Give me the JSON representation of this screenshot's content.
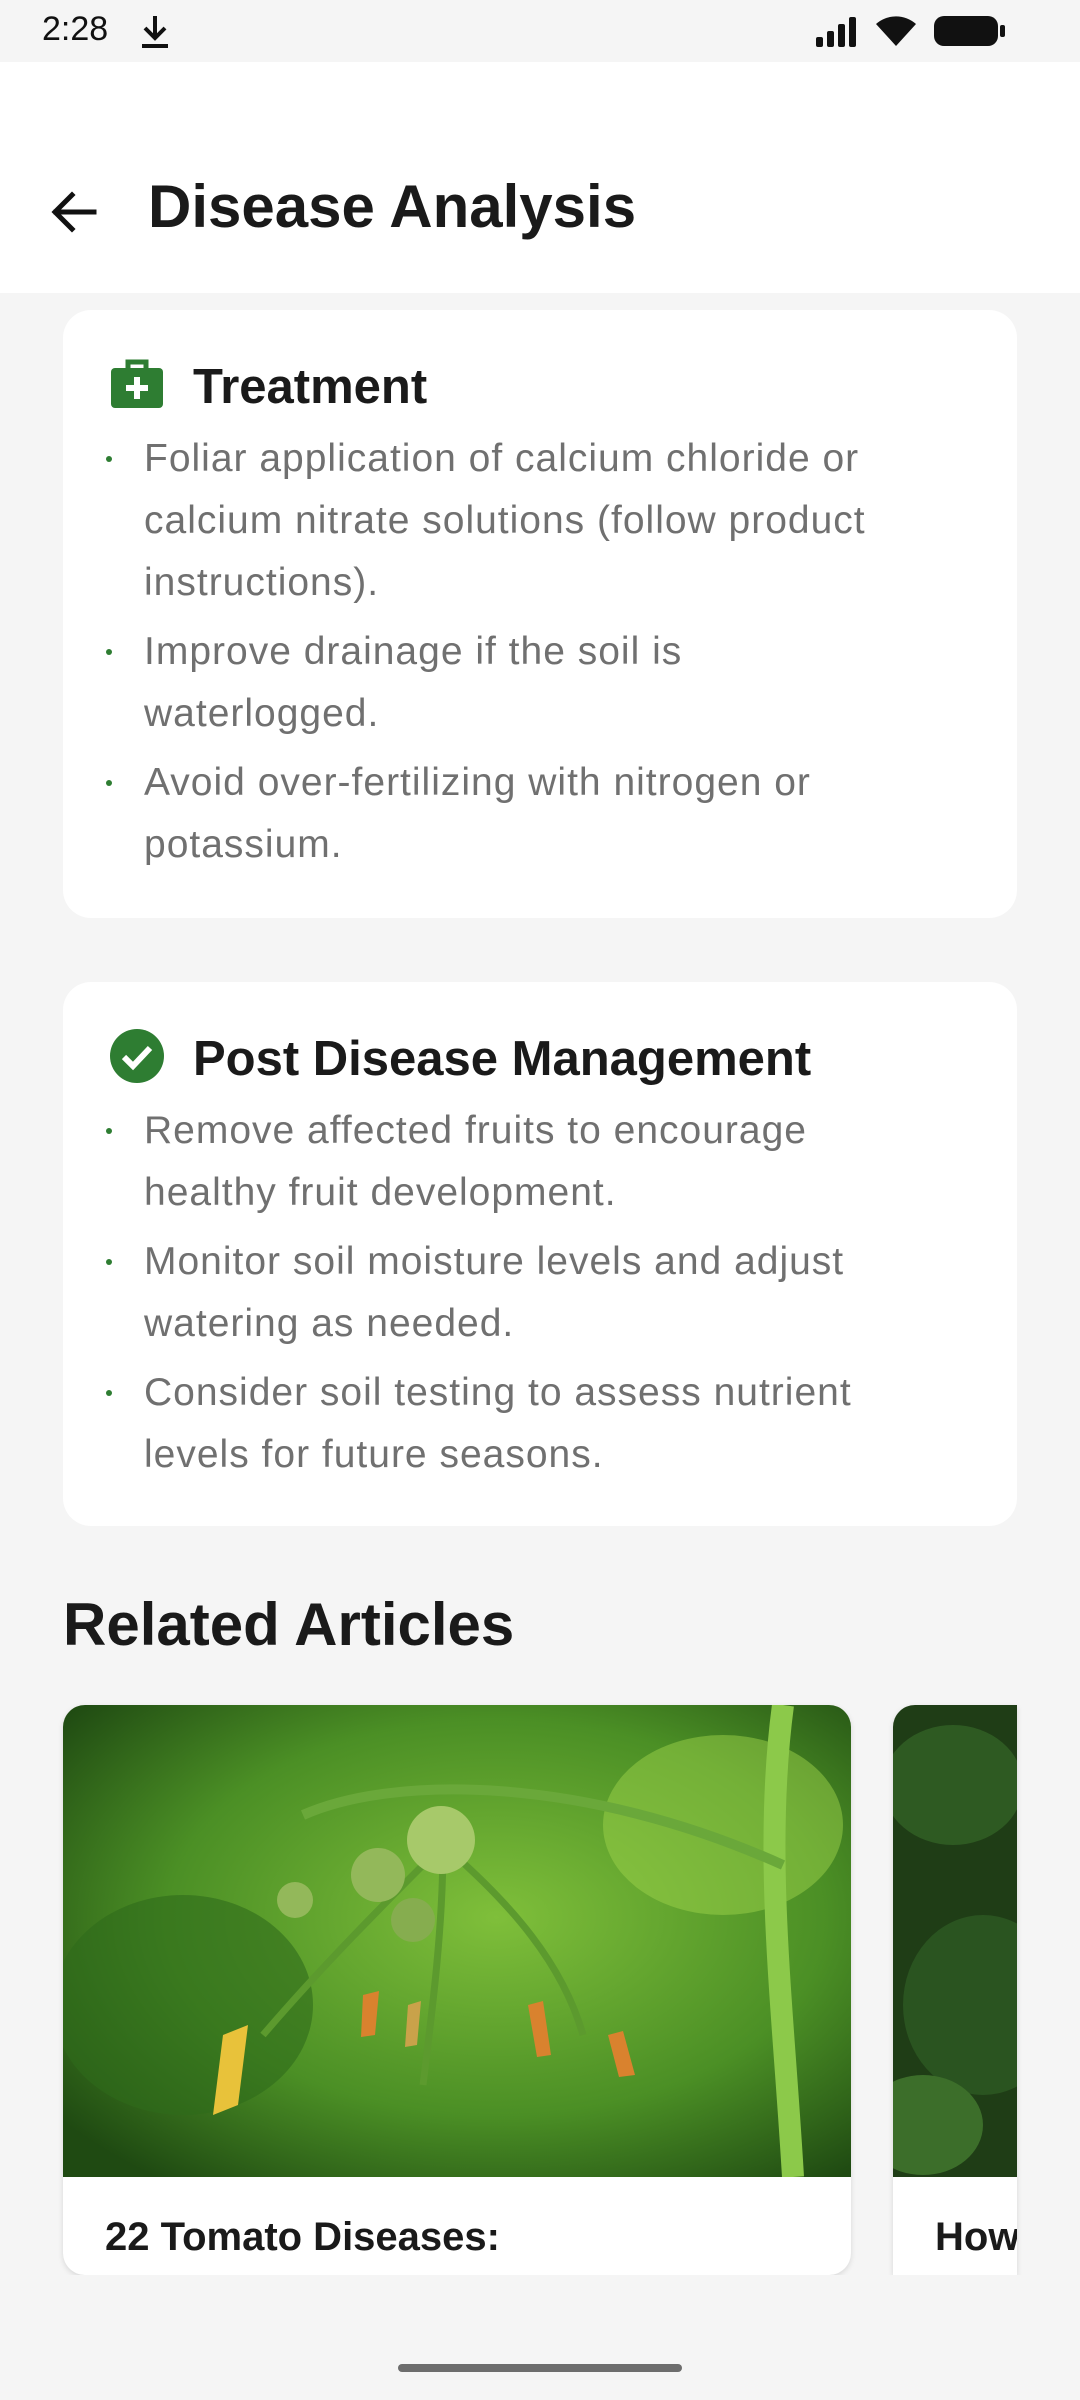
{
  "status_bar": {
    "time": "2:28",
    "icons": [
      "download-icon",
      "signal-icon",
      "wifi-icon",
      "battery-icon"
    ]
  },
  "app_bar": {
    "back_icon": "arrow-back-icon",
    "title": "Disease Analysis"
  },
  "colors": {
    "accent": "#2e7d32",
    "background": "#f5f5f5",
    "card": "#ffffff",
    "body_text": "#707070"
  },
  "treatment": {
    "icon": "medical-kit-icon",
    "title": "Treatment",
    "items": [
      "Foliar application of calcium chloride or calcium nitrate solutions (follow product instructions).",
      "Improve drainage if the soil is waterlogged.",
      "Avoid over-fertilizing with nitrogen or potassium."
    ]
  },
  "post_management": {
    "icon": "check-circle-icon",
    "title": "Post Disease Management",
    "items": [
      "Remove affected fruits to encourage healthy fruit development.",
      "Monitor soil moisture levels and adjust watering as needed.",
      "Consider soil testing to assess nutrient levels for future seasons."
    ]
  },
  "related": {
    "heading": "Related Articles",
    "articles": [
      {
        "title": "22 Tomato Diseases:"
      },
      {
        "title": "How"
      }
    ]
  }
}
